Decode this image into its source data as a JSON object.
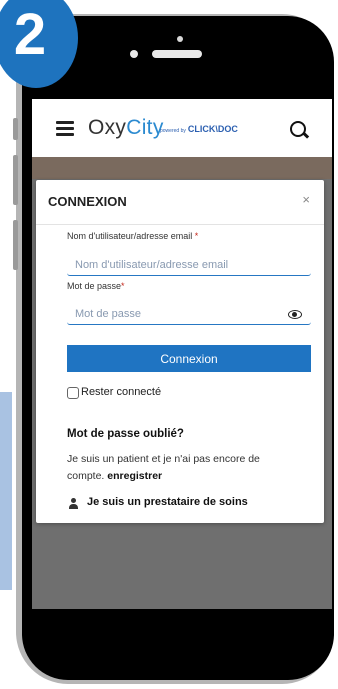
{
  "header": {
    "logo_oxy": "Oxy",
    "logo_city": "City",
    "powered_by": "powered by",
    "clickdoc": "CLICK\\DOC"
  },
  "step": {
    "number": "2"
  },
  "modal": {
    "title": "CONNEXION",
    "close": "×",
    "username_label": "Nom d'utilisateur/adresse email",
    "username_placeholder": "Nom d'utilisateur/adresse email",
    "password_label": "Mot de passe",
    "password_placeholder": "Mot de passe",
    "required_mark": "*",
    "connect_button": "Connexion",
    "remember_me": "Rester connecté",
    "forgot_password": "Mot de passe oublié?",
    "patient_text": "Je suis un patient et je n'ai pas encore de compte.",
    "register_link": "enregistrer",
    "provider_link": "Je suis un prestataire de soins"
  },
  "footer": {
    "facebook": "f",
    "twitter": "y",
    "linkedin": "in"
  },
  "colors": {
    "accent": "#1f74c2",
    "badge": "#1e73be",
    "required": "#c4281c"
  }
}
